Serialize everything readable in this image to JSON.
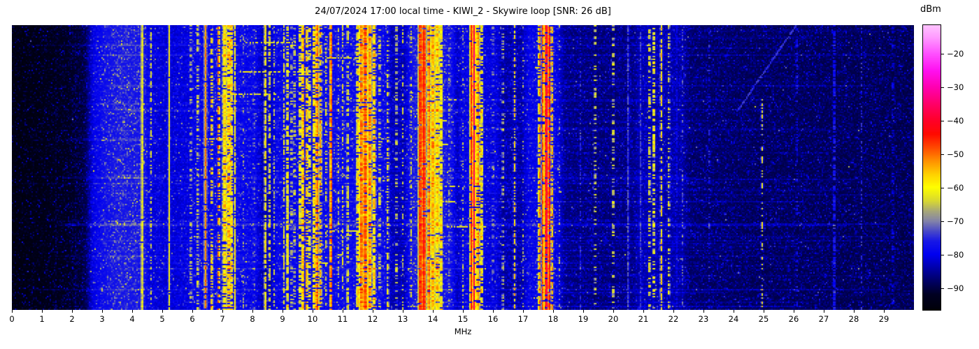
{
  "title": "24/07/2024 17:00 local time - KIWI_2 - Skywire loop [SNR: 26 dB]",
  "x_axis": {
    "label": "MHz",
    "tick_labels": [
      "0",
      "1",
      "2",
      "3",
      "4",
      "5",
      "6",
      "7",
      "8",
      "9",
      "10",
      "11",
      "12",
      "13",
      "14",
      "15",
      "16",
      "17",
      "18",
      "19",
      "20",
      "21",
      "22",
      "23",
      "24",
      "25",
      "26",
      "27",
      "28",
      "29"
    ],
    "tick_values": [
      0,
      1,
      2,
      3,
      4,
      5,
      6,
      7,
      8,
      9,
      10,
      11,
      12,
      13,
      14,
      15,
      16,
      17,
      18,
      19,
      20,
      21,
      22,
      23,
      24,
      25,
      26,
      27,
      28,
      29
    ],
    "range_mhz": [
      0,
      30
    ]
  },
  "y_axis": {
    "tick_labels": []
  },
  "colorbar": {
    "label": "dBm",
    "tick_labels": [
      "−20",
      "−30",
      "−40",
      "−50",
      "−60",
      "−70",
      "−80",
      "−90"
    ],
    "tick_values": [
      -20,
      -30,
      -40,
      -50,
      -60,
      -70,
      -80,
      -90
    ]
  },
  "chart_data": {
    "type": "heatmap",
    "title": "24/07/2024 17:00 local time - KIWI_2 - Skywire loop [SNR: 26 dB]",
    "xlabel": "MHz",
    "x_range_mhz": [
      0,
      30
    ],
    "colorbar_label": "dBm",
    "value_range_dbm": [
      -96.5,
      -11.5
    ],
    "colorbar_tick_values_dbm": [
      -20,
      -30,
      -40,
      -50,
      -60,
      -70,
      -80,
      -90
    ],
    "colormap_stops": [
      [
        -98.0,
        "#000002"
      ],
      [
        -92.0,
        "#000022"
      ],
      [
        -88.0,
        "#000064"
      ],
      [
        -84.0,
        "#0000aa"
      ],
      [
        -80.0,
        "#0000f0"
      ],
      [
        -76.0,
        "#1818e6"
      ],
      [
        -73.0,
        "#4a4ac8"
      ],
      [
        -70.0,
        "#8484a8"
      ],
      [
        -67.0,
        "#a8a878"
      ],
      [
        -64.0,
        "#d8d832"
      ],
      [
        -60.0,
        "#ffff00"
      ],
      [
        -56.0,
        "#ffd000"
      ],
      [
        -52.0,
        "#ff9000"
      ],
      [
        -48.0,
        "#ff4800"
      ],
      [
        -44.0,
        "#ff0a00"
      ],
      [
        -40.0,
        "#ff0028"
      ],
      [
        -35.0,
        "#ff0068"
      ],
      [
        -30.0,
        "#ff00b0"
      ],
      [
        -25.0,
        "#ff10f0"
      ],
      [
        -20.0,
        "#ff50ff"
      ],
      [
        -15.0,
        "#ff9cff"
      ],
      [
        -11.0,
        "#ffc8ff"
      ]
    ],
    "background_profile_dbm": [
      [
        0,
        -96.5
      ],
      [
        1.0,
        -95.5
      ],
      [
        1.8,
        -94
      ],
      [
        2.3,
        -92
      ],
      [
        2.7,
        -89
      ],
      [
        3.1,
        -86
      ],
      [
        3.6,
        -84.5
      ],
      [
        4.3,
        -85
      ],
      [
        5.2,
        -86
      ],
      [
        6.3,
        -85
      ],
      [
        7.3,
        -84.5
      ],
      [
        8.3,
        -85.5
      ],
      [
        9.3,
        -85
      ],
      [
        10.5,
        -84.5
      ],
      [
        11.8,
        -84
      ],
      [
        12.8,
        -85.5
      ],
      [
        13.8,
        -84
      ],
      [
        14.8,
        -85.5
      ],
      [
        15.8,
        -86.5
      ],
      [
        16.8,
        -86
      ],
      [
        17.8,
        -86.5
      ],
      [
        18.6,
        -88
      ],
      [
        19.5,
        -88.5
      ],
      [
        20.5,
        -88
      ],
      [
        21.5,
        -88.5
      ],
      [
        22.5,
        -89
      ],
      [
        23.5,
        -89.5
      ],
      [
        25.0,
        -90
      ],
      [
        26.5,
        -90
      ],
      [
        28.0,
        -90.2
      ],
      [
        30,
        -90.5
      ]
    ],
    "haze_bands_mhz": [
      [
        2.7,
        4.4,
        7
      ],
      [
        4.4,
        6.0,
        3
      ],
      [
        6.0,
        8.1,
        4
      ],
      [
        8.8,
        12.4,
        4
      ],
      [
        13.3,
        14.6,
        6
      ],
      [
        15.0,
        16.1,
        4
      ],
      [
        17.2,
        18.15,
        5
      ],
      [
        20.9,
        22.3,
        3
      ]
    ],
    "signal_fields": [
      "freq_mhz",
      "halfwidth_mhz",
      "level_dbm",
      "spread_db",
      "row_density",
      "y0_frac",
      "y1_frac"
    ],
    "signals": [
      [
        1.45,
        0.02,
        -88,
        3,
        0.5
      ],
      [
        2.1,
        0.02,
        -87,
        3,
        0.5
      ],
      [
        2.64,
        0.02,
        -83,
        3,
        0.6
      ],
      [
        4.33,
        0.02,
        -60,
        3,
        0.97
      ],
      [
        4.62,
        0.02,
        -63,
        5,
        0.45
      ],
      [
        5.23,
        0.02,
        -60,
        3,
        0.95
      ],
      [
        5.95,
        0.04,
        -66,
        6,
        0.4
      ],
      [
        6.18,
        0.03,
        -62,
        6,
        0.5
      ],
      [
        6.44,
        0.025,
        -52,
        5,
        0.9
      ],
      [
        6.64,
        0.02,
        -55,
        6,
        0.5
      ],
      [
        6.87,
        0.025,
        -50,
        6,
        0.55
      ],
      [
        7.08,
        0.06,
        -57,
        7,
        0.85
      ],
      [
        7.21,
        0.05,
        -55,
        7,
        0.8
      ],
      [
        7.26,
        0.02,
        -50,
        6,
        0.35
      ],
      [
        7.31,
        0.04,
        -58,
        7,
        0.7
      ],
      [
        7.42,
        0.02,
        -60,
        5,
        0.85
      ],
      [
        7.7,
        0.02,
        -68,
        6,
        0.3
      ],
      [
        8.05,
        0.02,
        -70,
        6,
        0.3
      ],
      [
        8.43,
        0.025,
        -58,
        6,
        0.8
      ],
      [
        8.57,
        0.02,
        -60,
        6,
        0.6
      ],
      [
        8.72,
        0.02,
        -65,
        6,
        0.4
      ],
      [
        9.05,
        0.02,
        -62,
        6,
        0.55
      ],
      [
        9.17,
        0.03,
        -58,
        6,
        0.7
      ],
      [
        9.3,
        0.02,
        -63,
        6,
        0.4
      ],
      [
        9.4,
        0.02,
        -62,
        6,
        0.4
      ],
      [
        9.58,
        0.02,
        -58,
        6,
        0.55
      ],
      [
        9.68,
        0.03,
        -52,
        6,
        0.85
      ],
      [
        9.8,
        0.03,
        -54,
        6,
        0.6
      ],
      [
        9.9,
        0.02,
        -58,
        6,
        0.5
      ],
      [
        10.05,
        0.03,
        -55,
        6,
        0.7
      ],
      [
        10.15,
        0.04,
        -50,
        6,
        0.8
      ],
      [
        10.26,
        0.03,
        -54,
        7,
        0.7
      ],
      [
        10.45,
        0.02,
        -62,
        6,
        0.4
      ],
      [
        10.61,
        0.02,
        -48,
        5,
        0.85
      ],
      [
        10.85,
        0.02,
        -64,
        6,
        0.4
      ],
      [
        11.0,
        0.02,
        -62,
        6,
        0.45
      ],
      [
        11.17,
        0.02,
        -60,
        6,
        0.5
      ],
      [
        11.5,
        0.03,
        -56,
        6,
        0.7
      ],
      [
        11.62,
        0.05,
        -50,
        6,
        0.9
      ],
      [
        11.75,
        0.06,
        -48,
        6,
        0.9
      ],
      [
        11.9,
        0.05,
        -52,
        7,
        0.85
      ],
      [
        12.05,
        0.04,
        -55,
        7,
        0.75
      ],
      [
        12.23,
        0.02,
        -62,
        6,
        0.4
      ],
      [
        12.5,
        0.02,
        -60,
        7,
        0.5
      ],
      [
        12.79,
        0.02,
        -63,
        6,
        0.4
      ],
      [
        13.0,
        0.02,
        -64,
        6,
        0.35
      ],
      [
        13.27,
        0.02,
        -62,
        6,
        0.4
      ],
      [
        13.58,
        0.04,
        -45,
        4,
        0.95
      ],
      [
        13.7,
        0.05,
        -44,
        5,
        0.97
      ],
      [
        13.87,
        0.04,
        -50,
        6,
        0.9
      ],
      [
        14.0,
        0.06,
        -54,
        7,
        0.92
      ],
      [
        14.15,
        0.06,
        -56,
        8,
        0.9
      ],
      [
        14.28,
        0.04,
        -58,
        8,
        0.8
      ],
      [
        14.55,
        0.02,
        -66,
        6,
        0.3
      ],
      [
        15.0,
        0.02,
        -66,
        6,
        0.3
      ],
      [
        15.28,
        0.03,
        -45,
        5,
        0.9
      ],
      [
        15.37,
        0.02,
        -37,
        4,
        0.9
      ],
      [
        15.5,
        0.04,
        -52,
        6,
        0.85
      ],
      [
        15.62,
        0.03,
        -56,
        7,
        0.7
      ],
      [
        16.0,
        0.02,
        -68,
        6,
        0.3
      ],
      [
        16.33,
        0.02,
        -64,
        6,
        0.35
      ],
      [
        16.72,
        0.02,
        -58,
        7,
        0.55
      ],
      [
        17.0,
        0.02,
        -68,
        6,
        0.3
      ],
      [
        17.55,
        0.03,
        -52,
        6,
        0.8
      ],
      [
        17.66,
        0.03,
        -48,
        5,
        0.9
      ],
      [
        17.78,
        0.025,
        -36,
        3,
        0.92
      ],
      [
        17.87,
        0.02,
        -42,
        4,
        0.85
      ],
      [
        17.97,
        0.03,
        -55,
        7,
        0.7
      ],
      [
        18.2,
        0.02,
        -68,
        6,
        0.3
      ],
      [
        18.9,
        0.02,
        -75,
        5,
        0.4
      ],
      [
        19.4,
        0.02,
        -62,
        6,
        0.3
      ],
      [
        20.0,
        0.02,
        -62,
        7,
        0.4
      ],
      [
        20.5,
        0.015,
        -72,
        4,
        0.8
      ],
      [
        20.9,
        0.015,
        -74,
        4,
        0.7
      ],
      [
        21.2,
        0.02,
        -60,
        7,
        0.45
      ],
      [
        21.35,
        0.03,
        -59,
        7,
        0.5
      ],
      [
        21.6,
        0.025,
        -58,
        6,
        0.7
      ],
      [
        21.85,
        0.02,
        -62,
        7,
        0.4
      ],
      [
        22.1,
        0.03,
        -78,
        4,
        0.7
      ],
      [
        22.3,
        0.02,
        -72,
        5,
        0.3
      ],
      [
        23.2,
        0.02,
        -74,
        5,
        0.3
      ],
      [
        24.95,
        0.02,
        -62,
        6,
        0.45,
        0.25,
        1.0
      ],
      [
        26.1,
        0.015,
        -76,
        4,
        0.3
      ],
      [
        27.35,
        0.015,
        -73,
        4,
        0.6
      ],
      [
        28.25,
        0.015,
        -75,
        4,
        0.35
      ],
      [
        29.3,
        0.015,
        -77,
        4,
        0.3
      ]
    ],
    "burst_bands_mhz": [
      [
        5.9,
        9.6
      ],
      [
        9.9,
        12.3
      ],
      [
        13.4,
        15.9
      ],
      [
        17.3,
        18.1
      ]
    ],
    "diagonal_streak": {
      "f0_mhz": 24.1,
      "y0_frac": 0.3,
      "f1_mhz": 26.05,
      "y1_frac": 0.0,
      "level_dbm": -77
    }
  }
}
